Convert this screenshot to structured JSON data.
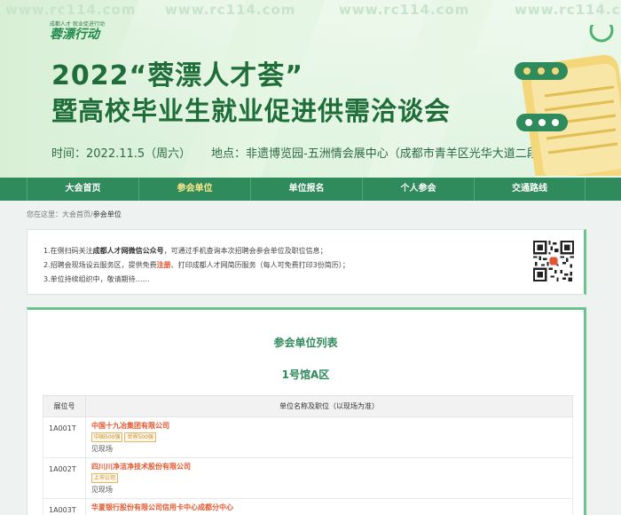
{
  "banner": {
    "watermarks": [
      "www.rc114.com",
      "www.rc114.com",
      "www.rc114.com",
      "www.rc114.com"
    ],
    "logo_small": "成都人才 就业促进行动",
    "logo_main": "蓉漂行动",
    "title_line1": "2022“蓉漂人才荟”",
    "title_line2": "暨高校毕业生就业促进供需洽谈会",
    "time_text": "时间：2022.11.5（周六）",
    "place_text": "地点：非遗博览园-五洲情会展中心（成都市青羊区光华大道二段）"
  },
  "nav": {
    "items": [
      {
        "label": "大会首页"
      },
      {
        "label": "参会单位"
      },
      {
        "label": "单位报名"
      },
      {
        "label": "个人参会"
      },
      {
        "label": "交通路线"
      }
    ]
  },
  "breadcrumb": {
    "prefix": "您在这里：",
    "home": "大会首页",
    "sep": "/",
    "current": "参会单位"
  },
  "notice": {
    "line1_pre": "1.在侧扫码关注",
    "line1_bold": "成都人才网微信公众号",
    "line1_post": "，可通过手机查询本次招聘会参会单位及职位信息；",
    "line2_pre": "2.招聘会现场设云服务区，提供免费",
    "line2_hl": "注册",
    "line2_post": "、打印成都人才网简历服务（每人可免费打印3份简历）；",
    "line3": "3.单位持续组织中，敬请期待……"
  },
  "main": {
    "list_title": "参会单位列表",
    "hall_title": "1号馆A区",
    "columns": [
      "展位号",
      "单位名称及职位（以现场为准）"
    ],
    "rows": [
      {
        "booth": "1A001T",
        "company": "中国十九冶集团有限公司",
        "tags": [
          "中国500强",
          "世界500强"
        ],
        "note": "见现场"
      },
      {
        "booth": "1A002T",
        "company": "四川川净洁净技术股份有限公司",
        "tags": [
          "上市公司"
        ],
        "note": "见现场"
      },
      {
        "booth": "1A003T",
        "company": "华夏银行股份有限公司信用卡中心成都分中心",
        "tags": [],
        "note": ""
      }
    ]
  },
  "colors": {
    "brand": "#2f8a5c",
    "accent": "#e4572e",
    "title": "#1f6e3a"
  }
}
